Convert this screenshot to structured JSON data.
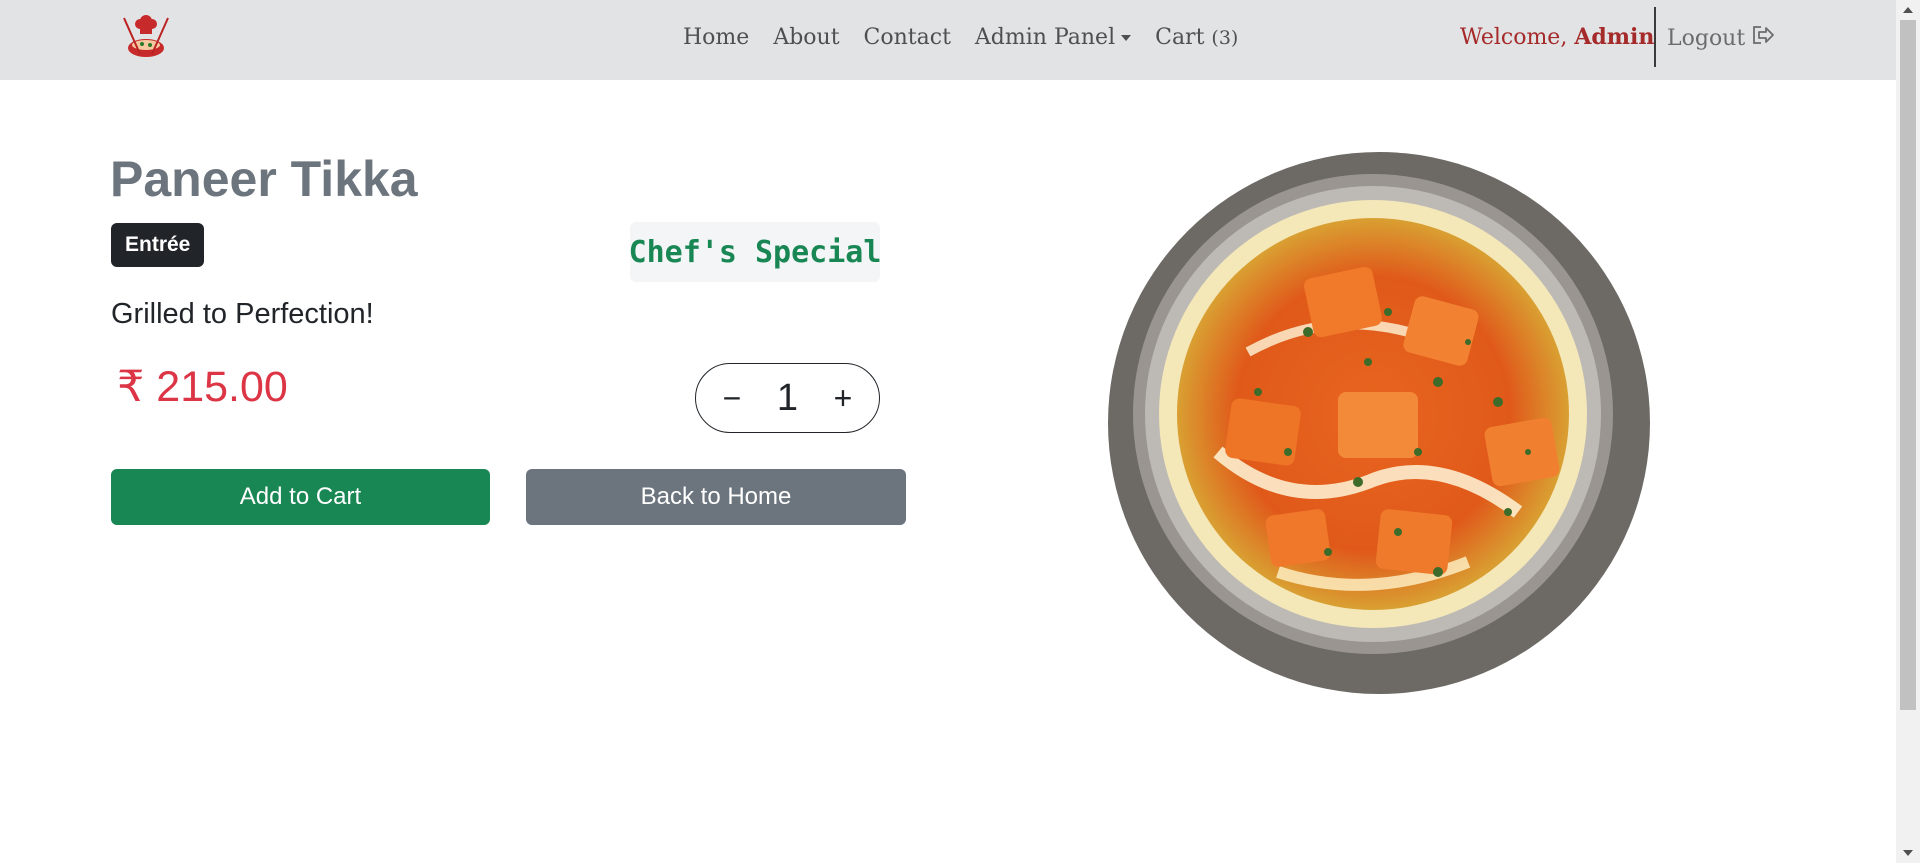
{
  "nav": {
    "links": [
      {
        "label": "Home"
      },
      {
        "label": "About"
      },
      {
        "label": "Contact"
      },
      {
        "label": "Admin Panel"
      },
      {
        "label": "Cart",
        "count": "(3)"
      }
    ],
    "welcome_prefix": "Welcome,",
    "welcome_name": "Admin",
    "logout_label": "Logout"
  },
  "product": {
    "name": "Paneer Tikka",
    "category": "Entrée",
    "special_label": "Chef's Special",
    "tagline": "Grilled to Perfection!",
    "price": "₹ 215.00",
    "quantity": "1",
    "minus_symbol": "−",
    "plus_symbol": "+"
  },
  "actions": {
    "add_to_cart": "Add to Cart",
    "back_home": "Back to Home"
  },
  "colors": {
    "navbar_bg": "#e2e3e5",
    "brand_red": "#a52a2a",
    "success": "#198754",
    "secondary": "#6c757d",
    "danger": "#dc3545",
    "dark": "#212529"
  },
  "icons": {
    "logo": "chef-logo-icon",
    "logout": "logout-icon",
    "dropdown": "caret-down-icon"
  }
}
